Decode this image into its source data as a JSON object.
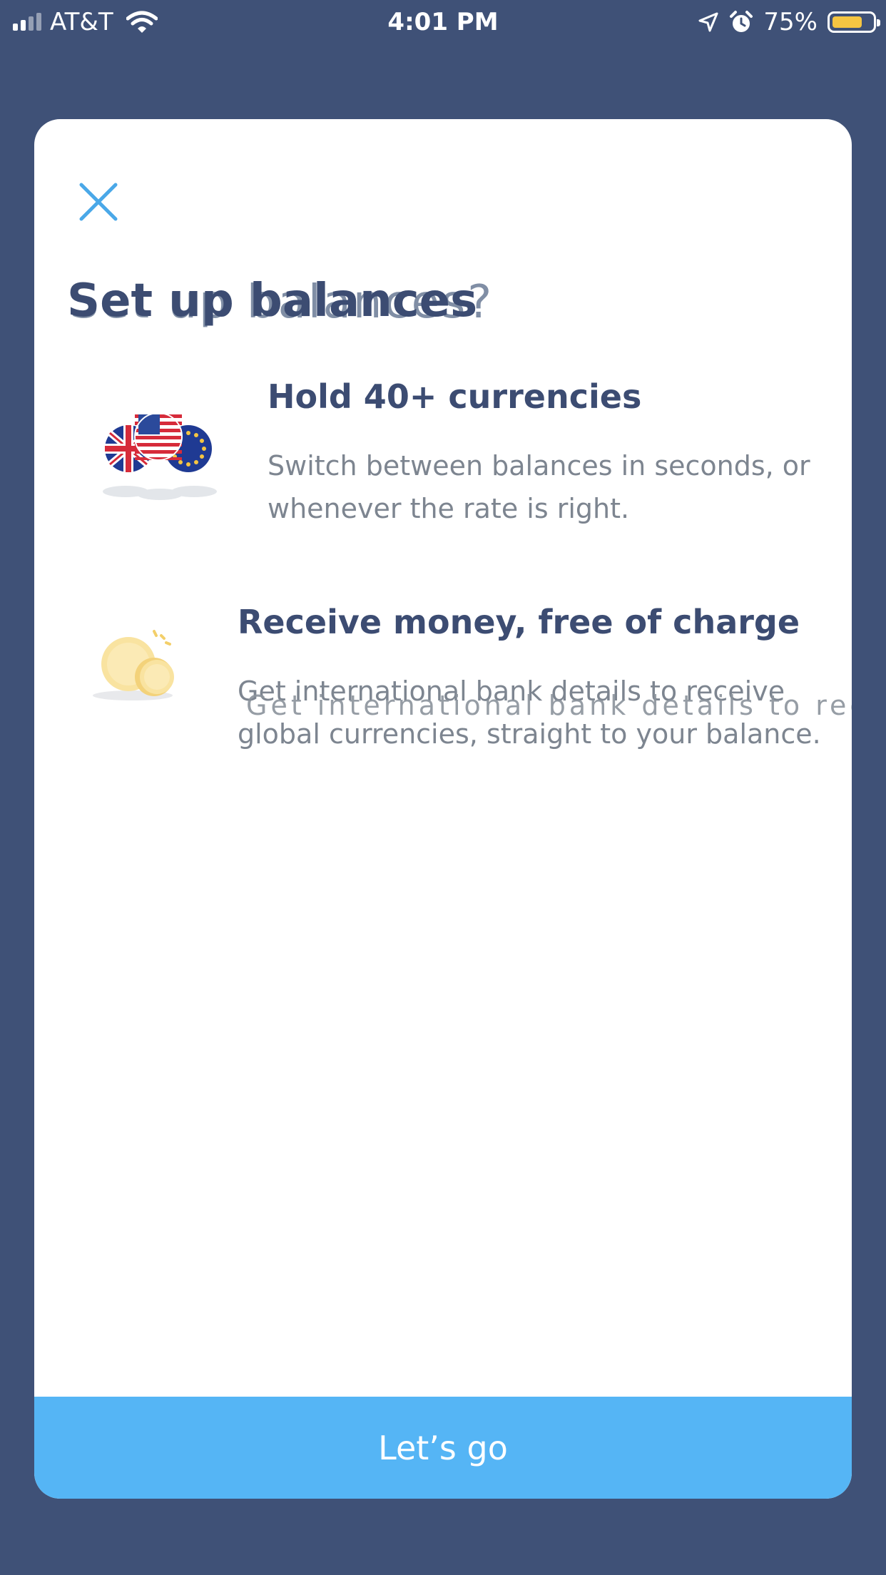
{
  "status_bar": {
    "carrier": "AT&T",
    "time": "4:01 PM",
    "battery_percent": "75%",
    "battery_level": 0.75,
    "icons": [
      "signal-icon",
      "wifi-icon",
      "location-icon",
      "alarm-icon",
      "battery-icon"
    ]
  },
  "modal": {
    "close_icon": "close-icon",
    "title": "Set up balances",
    "title_ghost": "Set up balances?",
    "features": [
      {
        "icon": "currency-flags-icon",
        "title": "Hold 40+ currencies",
        "description": "Switch between balances in seconds, or whenever the rate is right."
      },
      {
        "icon": "coins-icon",
        "title": "Receive money, free of charge",
        "description": "Get international bank details to receive global currencies, straight to your balance.",
        "description_ghost": "Get international bank details to receive"
      }
    ],
    "cta_label": "Let’s go"
  },
  "colors": {
    "background": "#3f5177",
    "card": "#ffffff",
    "heading": "#3c4c72",
    "body_text": "#7d8590",
    "accent": "#55b5f5",
    "close_icon": "#4aa8e8",
    "battery": "#f5c542"
  }
}
